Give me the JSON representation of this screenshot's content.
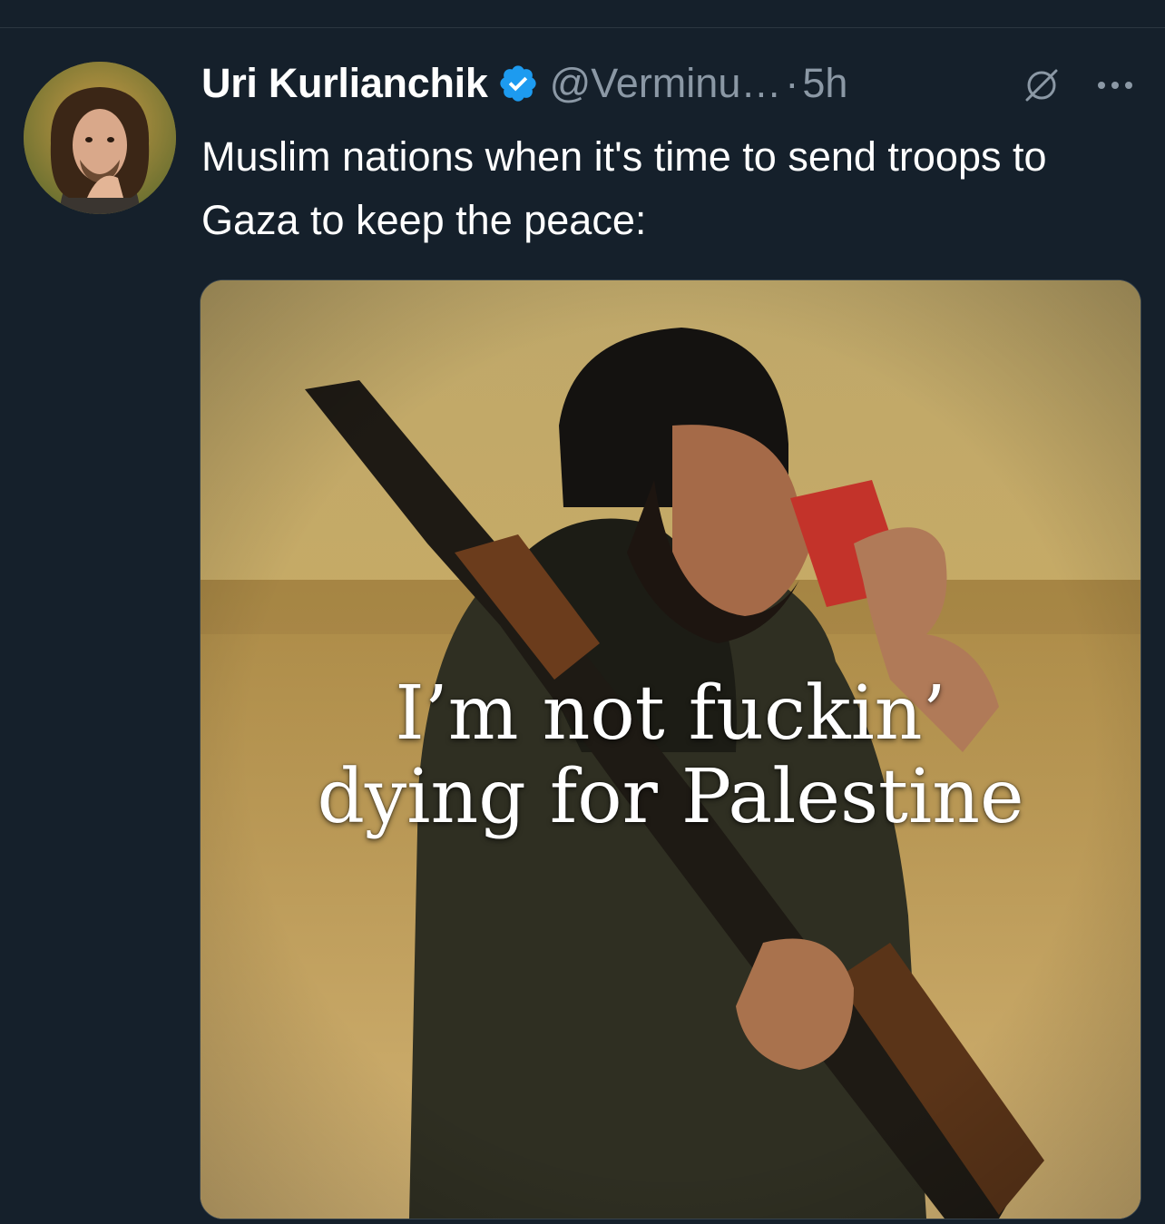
{
  "author": {
    "display_name": "Uri Kurlianchik",
    "handle": "@Verminu…",
    "verified": true
  },
  "meta": {
    "separator": "·",
    "time_ago": "5h"
  },
  "tweet": {
    "text": "Muslim nations when it's time to send troops to Gaza to keep the peace:"
  },
  "media": {
    "caption_line1": "I’m not fuckin’",
    "caption_line2": "dying for Palestine"
  },
  "colors": {
    "background": "#15202b",
    "secondary_text": "#8b98a5",
    "verified_blue": "#1d9bf0"
  },
  "icons": {
    "verified": "verified-badge-icon",
    "grok": "grok-icon",
    "more": "more-options-icon"
  }
}
